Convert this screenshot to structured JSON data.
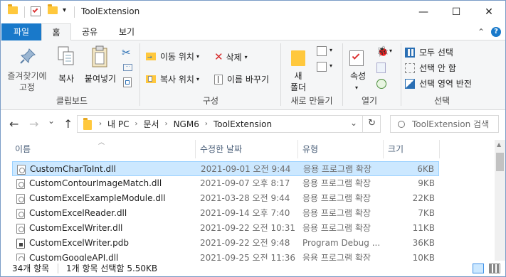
{
  "window": {
    "title": "ToolExtension",
    "minimize": "—",
    "maximize": "☐",
    "close": "✕"
  },
  "tabs": {
    "file": "파일",
    "home": "홈",
    "share": "공유",
    "view": "보기",
    "collapse": "⌃",
    "help": "?"
  },
  "ribbon": {
    "pin_label_1": "즐겨찾기에",
    "pin_label_2": "고정",
    "copy": "복사",
    "paste": "붙여넣기",
    "move_to": "이동 위치",
    "copy_to": "복사 위치",
    "delete": "삭제",
    "rename": "이름 바꾸기",
    "new_folder_1": "새",
    "new_folder_2": "폴더",
    "properties": "속성",
    "select_all": "모두 선택",
    "select_none": "선택 안 함",
    "invert_selection": "선택 영역 반전",
    "groups": {
      "clipboard": "클립보드",
      "organize": "구성",
      "new": "새로 만들기",
      "open": "열기",
      "select": "선택"
    }
  },
  "nav": {
    "back": "←",
    "forward": "→",
    "recent": "⌄",
    "up": "↑",
    "breadcrumb": [
      "내 PC",
      "문서",
      "NGM6",
      "ToolExtension"
    ],
    "refresh": "↻",
    "dropdown": "⌄",
    "search_placeholder": "ToolExtension 검색"
  },
  "columns": {
    "name": "이름",
    "date": "수정한 날짜",
    "type": "유형",
    "size": "크기"
  },
  "files": [
    {
      "name": "CustomCharToInt.dll",
      "date": "2021-09-01 오전 9:44",
      "type": "응용 프로그램 확장",
      "size": "6KB",
      "kind": "dll",
      "selected": true
    },
    {
      "name": "CustomContourImageMatch.dll",
      "date": "2021-09-07 오후 8:17",
      "type": "응용 프로그램 확장",
      "size": "9KB",
      "kind": "dll",
      "selected": false
    },
    {
      "name": "CustomExcelExampleModule.dll",
      "date": "2021-03-28 오전 9:44",
      "type": "응용 프로그램 확장",
      "size": "22KB",
      "kind": "dll",
      "selected": false
    },
    {
      "name": "CustomExcelReader.dll",
      "date": "2021-09-14 오후 7:40",
      "type": "응용 프로그램 확장",
      "size": "7KB",
      "kind": "dll",
      "selected": false
    },
    {
      "name": "CustomExcelWriter.dll",
      "date": "2021-09-22 오전 10:31",
      "type": "응용 프로그램 확장",
      "size": "11KB",
      "kind": "dll",
      "selected": false
    },
    {
      "name": "CustomExcelWriter.pdb",
      "date": "2021-09-22 오전 9:48",
      "type": "Program Debug ...",
      "size": "36KB",
      "kind": "pdb",
      "selected": false
    },
    {
      "name": "CustomGoogleAPI.dll",
      "date": "2021-09-25 오전 11:36",
      "type": "응용 프로그램 확장",
      "size": "10KB",
      "kind": "dll",
      "selected": false
    }
  ],
  "status": {
    "count": "34개 항목",
    "selection": "1개 항목 선택함 5.50KB"
  },
  "colors": {
    "accent": "#1979ca",
    "selection_bg": "#cce8ff",
    "selection_border": "#99d1ff",
    "ribbon_bg": "#f5f6f7",
    "folder": "#ffc83d",
    "delete_red": "#d72b2b"
  }
}
